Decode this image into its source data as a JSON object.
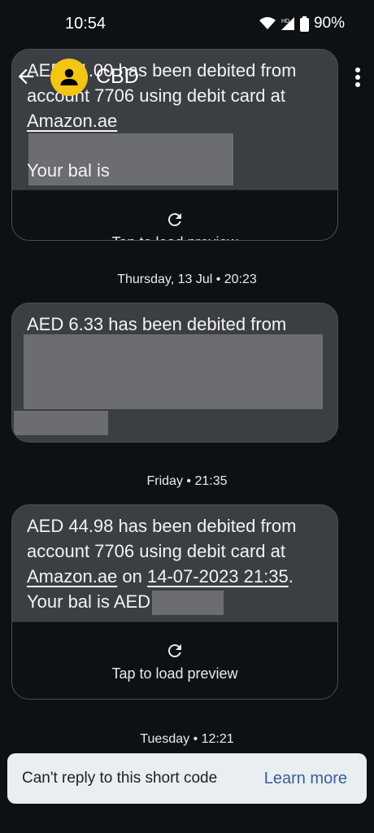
{
  "status_bar": {
    "time": "10:54",
    "battery": "90%",
    "icons": [
      "wifi-icon",
      "hd-signal-icon",
      "battery-icon"
    ]
  },
  "header": {
    "contact_name": "CBD",
    "avatar_icon": "person-icon"
  },
  "messages": [
    {
      "text_line1": "AED 41.00 has been debited from",
      "text_line2": "account 7706 using debit card at",
      "link": "Amazon.ae",
      "text_line4": "Your bal is",
      "preview_label": "Tap to load preview"
    },
    {
      "date": "Thursday, 13 Jul • 20:23",
      "text_line1": "AED 6.33 has been debited from"
    },
    {
      "date": "Friday • 21:35",
      "text_line1": "AED 44.98 has been debited from",
      "text_line2": "account 7706 using debit card at",
      "link": "Amazon.ae",
      "on_text": " on ",
      "datetime": "14-07-2023 21:35",
      "period": ".",
      "text_line4": "Your bal is AED",
      "preview_label": "Tap to load preview"
    }
  ],
  "next_date": "Tuesday • 12:21",
  "snackbar": {
    "message": "Can't reply to this short code",
    "action": "Learn more"
  }
}
